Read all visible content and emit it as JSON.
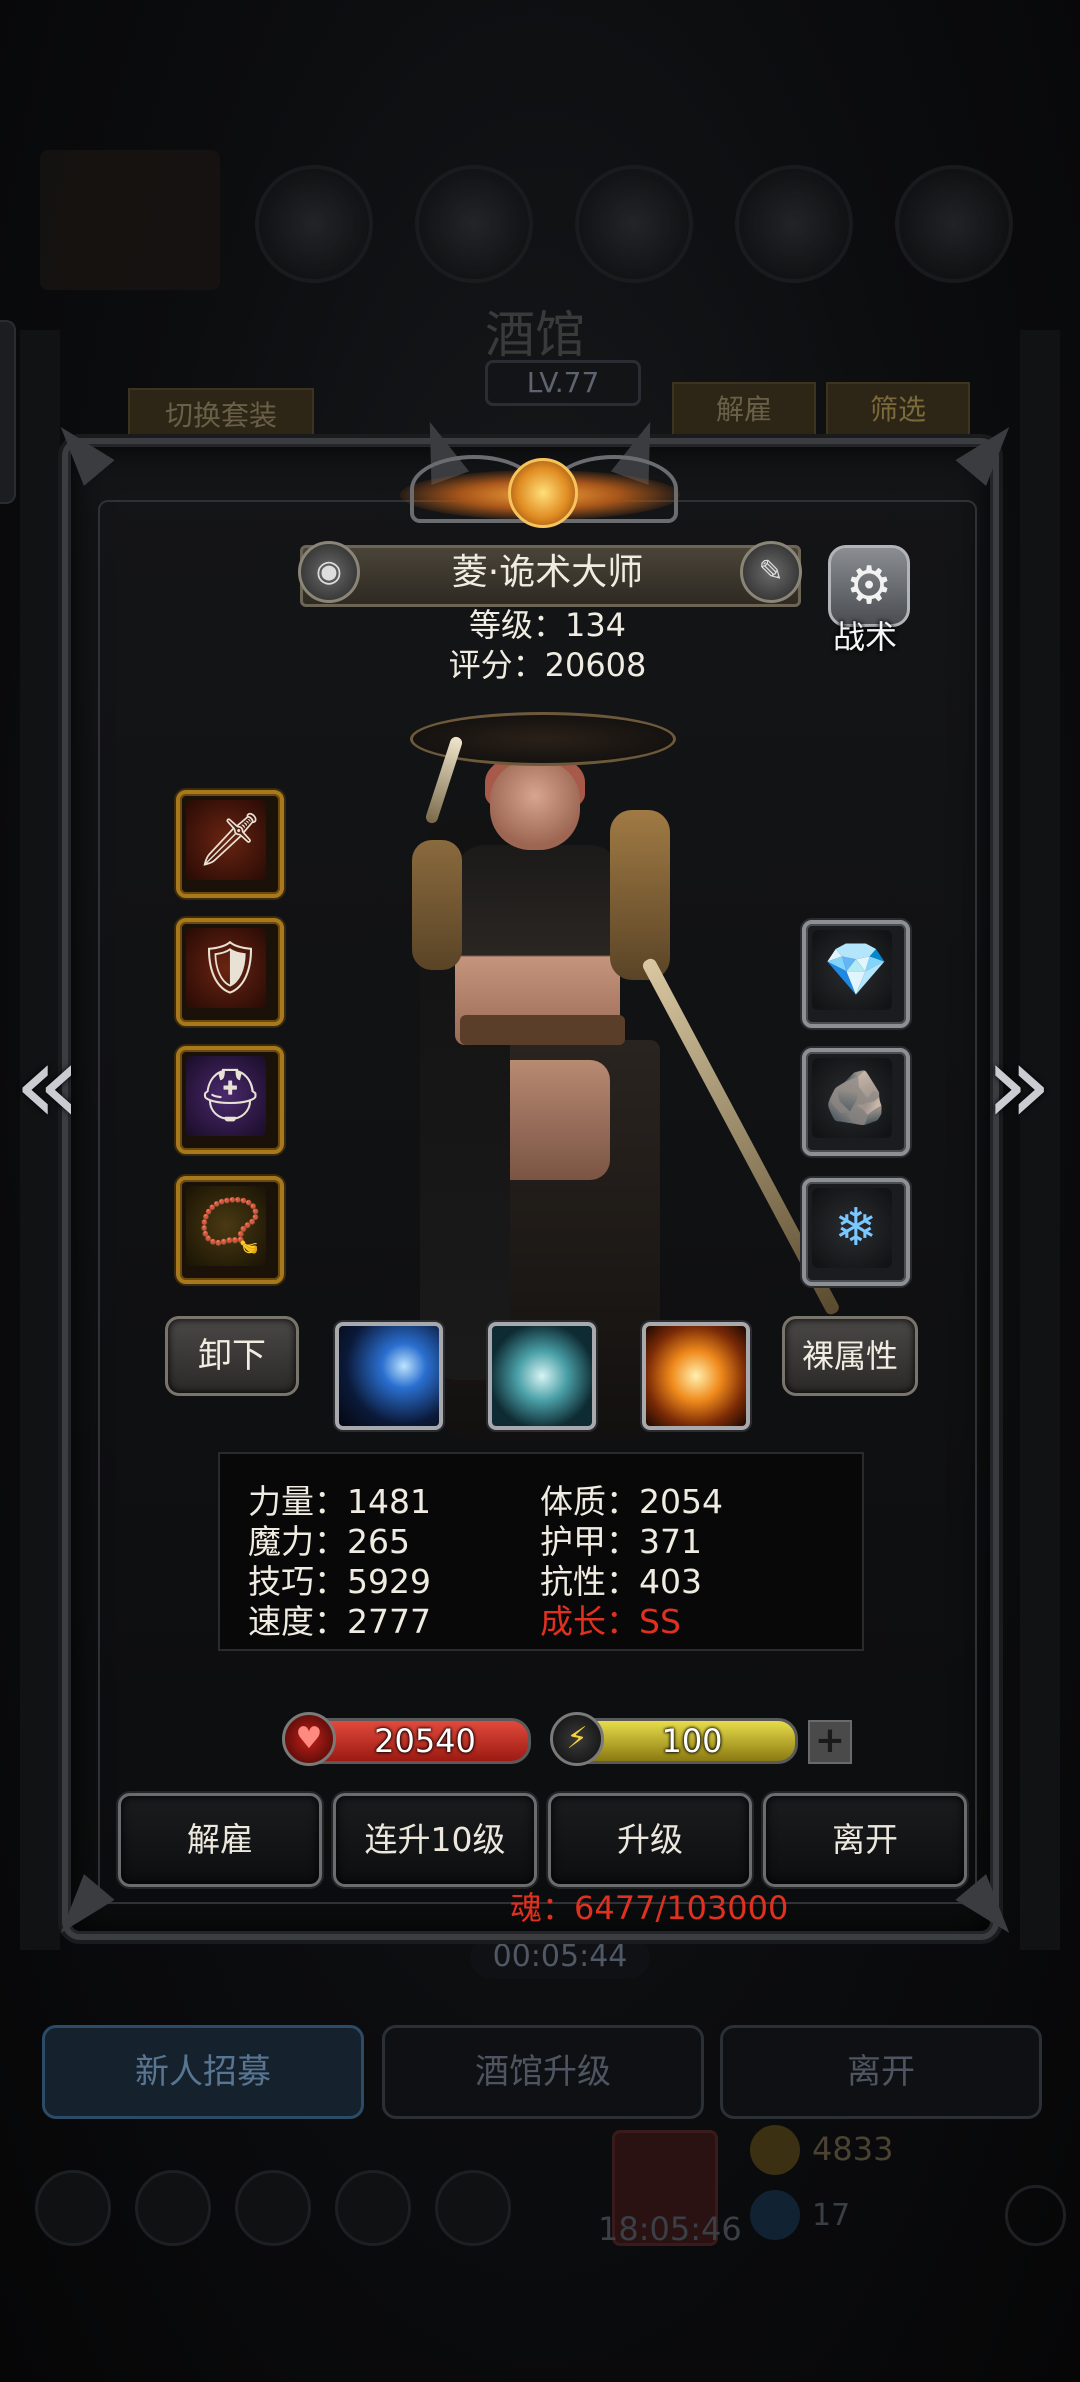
{
  "background": {
    "title": "酒馆",
    "level": "LV.77",
    "switch_outfit": "切换套装",
    "dismiss": "解雇",
    "filter": "筛选",
    "timer": "00:05:44",
    "bottom_tabs": [
      "新人招募",
      "酒馆升级",
      "离开"
    ],
    "clock": "18:05:46",
    "gold": "4833",
    "gems": "17"
  },
  "hero": {
    "name": "菱·诡术大师",
    "level_label": "等级：134",
    "score_label": "评分：20608",
    "tactic_label": "战术"
  },
  "equipment_left": [
    {
      "name": "weapon-slot",
      "icon": "blade-icon",
      "glyph": "🗡"
    },
    {
      "name": "armor-slot",
      "icon": "armor-icon",
      "glyph": "🛡"
    },
    {
      "name": "helmet-slot",
      "icon": "helmet-icon",
      "glyph": "⛑"
    },
    {
      "name": "necklace-slot",
      "icon": "necklace-icon",
      "glyph": "📿"
    }
  ],
  "equipment_right": [
    {
      "name": "crystal-slot",
      "icon": "green-crystal-icon",
      "glyph": "💎"
    },
    {
      "name": "stone-slot",
      "icon": "teal-stone-icon",
      "glyph": "🪨"
    },
    {
      "name": "spirit-slot",
      "icon": "blue-spirit-icon",
      "glyph": "❄"
    }
  ],
  "buttons": {
    "unequip": "卸下",
    "base_stats": "裸属性"
  },
  "stats": {
    "strength": "力量：1481",
    "constitution": "体质：2054",
    "magic": "魔力：265",
    "armor": "护甲：371",
    "skill": "技巧：5929",
    "resistance": "抗性：403",
    "speed": "速度：2777",
    "growth": "成长：SS"
  },
  "bars": {
    "hp": "20540",
    "energy": "100"
  },
  "actions": [
    "解雇",
    "连升10级",
    "升级",
    "离开"
  ],
  "soul": "魂：6477/103000",
  "colors": {
    "growth": "#e0301f",
    "soul": "#e0301f",
    "slot_gold": "#a8781c",
    "slot_silver": "#8c8f94"
  }
}
